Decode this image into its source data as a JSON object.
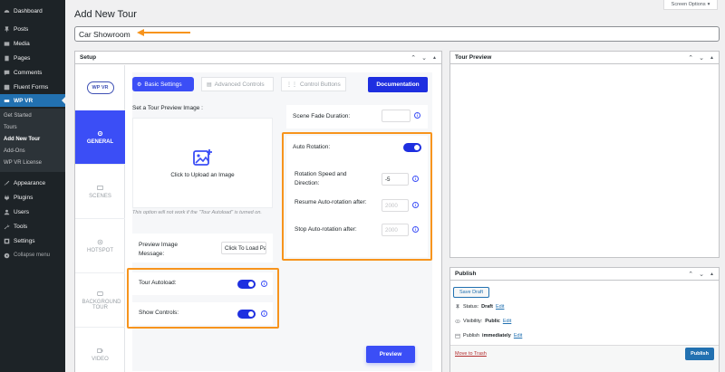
{
  "sidebar": {
    "items": [
      {
        "label": "Dashboard",
        "icon": "dashboard-icon"
      },
      {
        "label": "Posts",
        "icon": "pin-icon"
      },
      {
        "label": "Media",
        "icon": "media-icon"
      },
      {
        "label": "Pages",
        "icon": "page-icon"
      },
      {
        "label": "Comments",
        "icon": "comment-icon"
      },
      {
        "label": "Fluent Forms",
        "icon": "forms-icon"
      },
      {
        "label": "WP VR",
        "icon": "vr-icon"
      },
      {
        "label": "Appearance",
        "icon": "brush-icon"
      },
      {
        "label": "Plugins",
        "icon": "plug-icon"
      },
      {
        "label": "Users",
        "icon": "users-icon"
      },
      {
        "label": "Tools",
        "icon": "wrench-icon"
      },
      {
        "label": "Settings",
        "icon": "settings-icon"
      },
      {
        "label": "Collapse menu",
        "icon": "collapse-icon"
      }
    ],
    "submenu": [
      "Get Started",
      "Tours",
      "Add New Tour",
      "Add-Ons",
      "WP VR License"
    ]
  },
  "header": {
    "screen_options": "Screen Options",
    "title": "Add New Tour",
    "tour_title_value": "Car Showroom"
  },
  "setup": {
    "title": "Setup",
    "logo": "WP VR",
    "side_tabs": [
      "GENERAL",
      "SCENES",
      "HOTSPOT",
      "BACKGROUND TOUR",
      "VIDEO"
    ],
    "top_tabs": [
      "Basic Settings",
      "Advanced Controls",
      "Control Buttons"
    ],
    "documentation_label": "Documentation",
    "preview_image_label": "Set a Tour Preview Image :",
    "upload_text": "Click to Upload an Image",
    "upload_note": "This option will not work if the \"Tour Autoload\" is turned on.",
    "preview_message_label": "Preview Image Message:",
    "preview_message_value": "Click To Load Panorama",
    "tour_autoload_label": "Tour Autoload:",
    "show_controls_label": "Show Controls:",
    "scene_fade_label": "Scene Fade Duration:",
    "scene_fade_value": "",
    "auto_rotation_label": "Auto Rotation:",
    "rotation_speed_label": "Rotation Speed and Direction:",
    "rotation_speed_value": "-5",
    "resume_label": "Resume Auto-rotation after:",
    "resume_value": "2000",
    "stop_label": "Stop Auto-rotation after:",
    "stop_value": "2000",
    "preview_button": "Preview",
    "tour_autoload_on": true,
    "show_controls_on": true,
    "auto_rotation_on": true
  },
  "tour_preview": {
    "title": "Tour Preview"
  },
  "publish": {
    "title": "Publish",
    "save_draft": "Save Draft",
    "status_label": "Status:",
    "status_value": "Draft",
    "visibility_label": "Visibility:",
    "visibility_value": "Public",
    "publish_label": "Publish",
    "publish_value": "immediately",
    "edit_link": "Edit",
    "trash_link": "Move to Trash",
    "publish_button": "Publish"
  },
  "colors": {
    "accent": "#3b4ef6",
    "highlight": "#f7941d",
    "wp_blue": "#2271b1",
    "sidebar_bg": "#1d2327"
  }
}
